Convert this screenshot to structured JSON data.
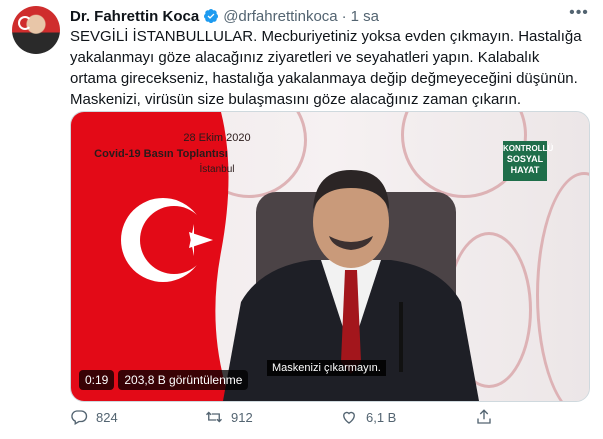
{
  "user": {
    "name": "Dr. Fahrettin Koca",
    "handle": "@drfahrettinkoca",
    "separator": "·",
    "time": "1 sa"
  },
  "tweet": {
    "text": "SEVGİLİ İSTANBULLULAR. Mecburiyetiniz yoksa evden çıkmayın. Hastalığa yakalanmayı göze alacağınız ziyaretleri ve seyahatleri yapın. Kalabalık ortama girecekseniz, hastalığa yakalanmaya değip değmeyeceğini düşünün. Maskenizi, virüsün size bulaşmasını göze alacağınız zaman çıkarın."
  },
  "video": {
    "overlay_date": "28 Ekim 2020",
    "overlay_title": "Covid-19 Basın Toplantısı",
    "overlay_city": "İstanbul",
    "badge_line1": "KONTROLLÜ",
    "badge_line2": "SOSYAL",
    "badge_line3": "HAYAT",
    "subtitle": "Maskenizi çıkarmayın.",
    "duration": "0:19",
    "views": "203,8 B görüntülenme"
  },
  "actions": {
    "reply_count": "824",
    "retweet_count": "912",
    "like_count": "6,1 B"
  },
  "colors": {
    "verified": "#1d9bf0",
    "secondary_text": "#536471",
    "flag_red": "#e30a17"
  }
}
